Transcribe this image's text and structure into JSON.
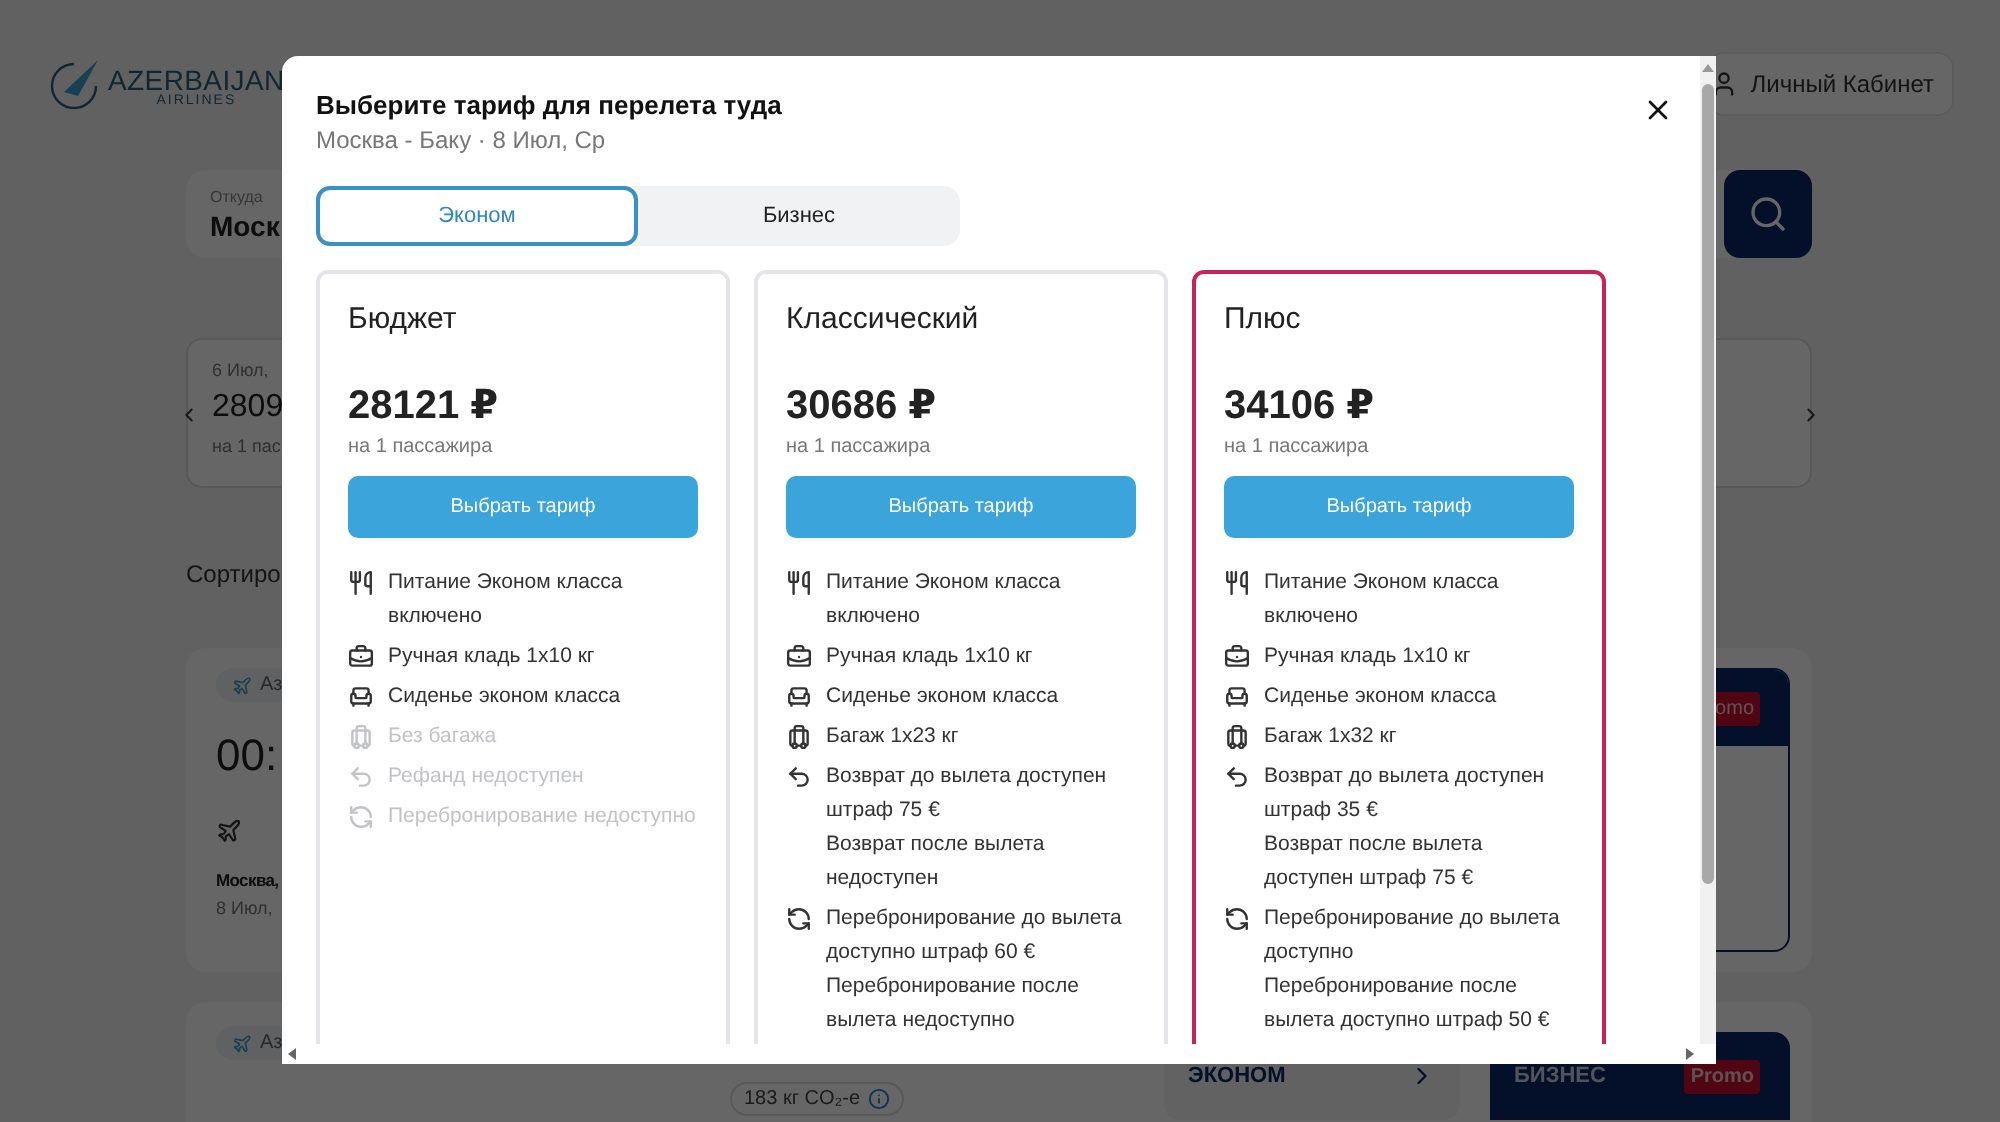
{
  "header": {
    "logo_top": "AZERBAIJAN",
    "logo_bottom": "AIRLINES",
    "account": "Личный Кабинет"
  },
  "search": {
    "from_label": "Откуда",
    "from_value": "Моск"
  },
  "date_strip": {
    "date": "6 Июл,",
    "price": "2809",
    "note": "на 1 пас"
  },
  "sort_label": "Сортиро",
  "flight": {
    "airline": "Аз",
    "time": "00:",
    "city": "Москва,",
    "date": "8 Июл,",
    "fare_badge": "omo"
  },
  "second_flight": {
    "airline": "Аз",
    "emission": "183 кг CO₂-e",
    "economy": "ЭКОНОМ",
    "business": "БИЗНЕС",
    "badge": "Promo"
  },
  "modal": {
    "title": "Выберите тариф для перелета туда",
    "subtitle": "Москва - Баку · 8 Июл, Ср",
    "tabs": [
      {
        "label": "Эконом",
        "selected": true
      },
      {
        "label": "Бизнес",
        "selected": false
      }
    ],
    "fares": [
      {
        "name": "Бюджет",
        "price": "28121 ₽",
        "per": "на 1 пассажира",
        "button": "Выбрать тариф",
        "selected": false,
        "features": [
          {
            "kind": "meal",
            "available": true,
            "lines": [
              "Питание Эконом класса включено"
            ]
          },
          {
            "kind": "hand",
            "available": true,
            "lines": [
              "Ручная кладь 1x10 кг"
            ]
          },
          {
            "kind": "seat",
            "available": true,
            "lines": [
              "Сиденье эконом класса"
            ]
          },
          {
            "kind": "bag",
            "available": false,
            "lines": [
              "Без багажа"
            ]
          },
          {
            "kind": "refund",
            "available": false,
            "lines": [
              "Рефанд недоступен"
            ]
          },
          {
            "kind": "rebook",
            "available": false,
            "lines": [
              "Перебронирование недоступно"
            ]
          }
        ]
      },
      {
        "name": "Классический",
        "price": "30686 ₽",
        "per": "на 1 пассажира",
        "button": "Выбрать тариф",
        "selected": false,
        "features": [
          {
            "kind": "meal",
            "available": true,
            "lines": [
              "Питание Эконом класса включено"
            ]
          },
          {
            "kind": "hand",
            "available": true,
            "lines": [
              "Ручная кладь 1x10 кг"
            ]
          },
          {
            "kind": "seat",
            "available": true,
            "lines": [
              "Сиденье эконом класса"
            ]
          },
          {
            "kind": "bag",
            "available": true,
            "lines": [
              "Багаж 1x23 кг"
            ]
          },
          {
            "kind": "refund",
            "available": true,
            "lines": [
              "Возврат до вылета доступен штраф 75 €",
              "Возврат после вылета недоступен"
            ]
          },
          {
            "kind": "rebook",
            "available": true,
            "lines": [
              "Перебронирование до вылета доступно штраф 60 €",
              "Перебронирование после вылета недоступно"
            ]
          }
        ]
      },
      {
        "name": "Плюс",
        "price": "34106 ₽",
        "per": "на 1 пассажира",
        "button": "Выбрать тариф",
        "selected": true,
        "features": [
          {
            "kind": "meal",
            "available": true,
            "lines": [
              "Питание Эконом класса включено"
            ]
          },
          {
            "kind": "hand",
            "available": true,
            "lines": [
              "Ручная кладь 1x10 кг"
            ]
          },
          {
            "kind": "seat",
            "available": true,
            "lines": [
              "Сиденье эконом класса"
            ]
          },
          {
            "kind": "bag",
            "available": true,
            "lines": [
              "Багаж 1x32 кг"
            ]
          },
          {
            "kind": "refund",
            "available": true,
            "lines": [
              "Возврат до вылета доступен штраф 35 €",
              "Возврат после вылета доступен штраф 75 €"
            ]
          },
          {
            "kind": "rebook",
            "available": true,
            "lines": [
              "Перебронирование до вылета доступно",
              "Перебронирование после вылета доступно штраф 50 €"
            ]
          }
        ]
      }
    ]
  }
}
